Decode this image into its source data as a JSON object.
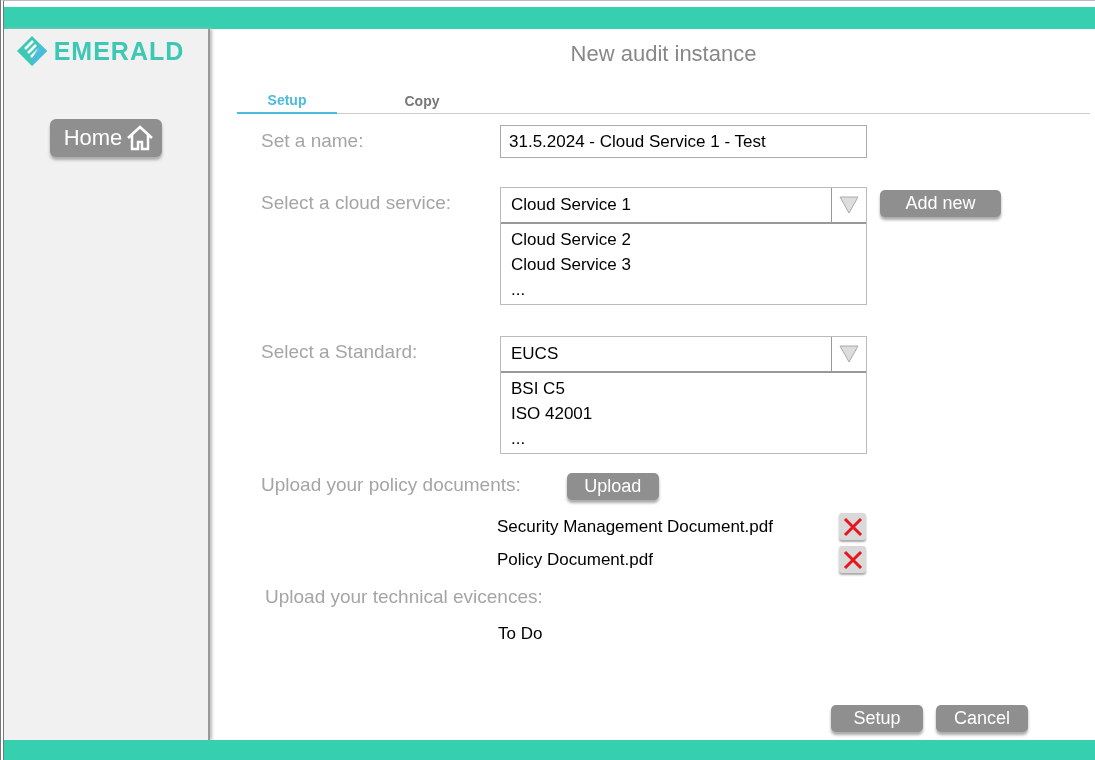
{
  "window": {
    "brand": "EMERALD",
    "title": "New audit instance"
  },
  "sidebar": {
    "home_button": "Home"
  },
  "tabs": [
    {
      "label": "Setup",
      "selected": true
    },
    {
      "label": "Copy",
      "selected": false
    }
  ],
  "form": {
    "name": {
      "label": "Set a name:",
      "value": "31.5.2024 - Cloud Service 1 - Test"
    },
    "cloud_service": {
      "label": "Select a cloud service:",
      "selected": "Cloud Service 1",
      "options": [
        "Cloud Service 2",
        "Cloud Service 3",
        "..."
      ],
      "action": "Add new"
    },
    "standard": {
      "label": "Select a Standard:",
      "selected": "EUCS",
      "options": [
        "BSI C5",
        "ISO 42001",
        "..."
      ]
    },
    "policy_documents": {
      "label": "Upload your policy documents:",
      "action": "Upload",
      "files": [
        "Security Management Document.pdf",
        "Policy Document.pdf"
      ]
    },
    "technical_evidences": {
      "label": "Upload your technical evicences:",
      "note": "To Do"
    }
  },
  "buttons": [
    "Setup",
    "Cancel"
  ]
}
